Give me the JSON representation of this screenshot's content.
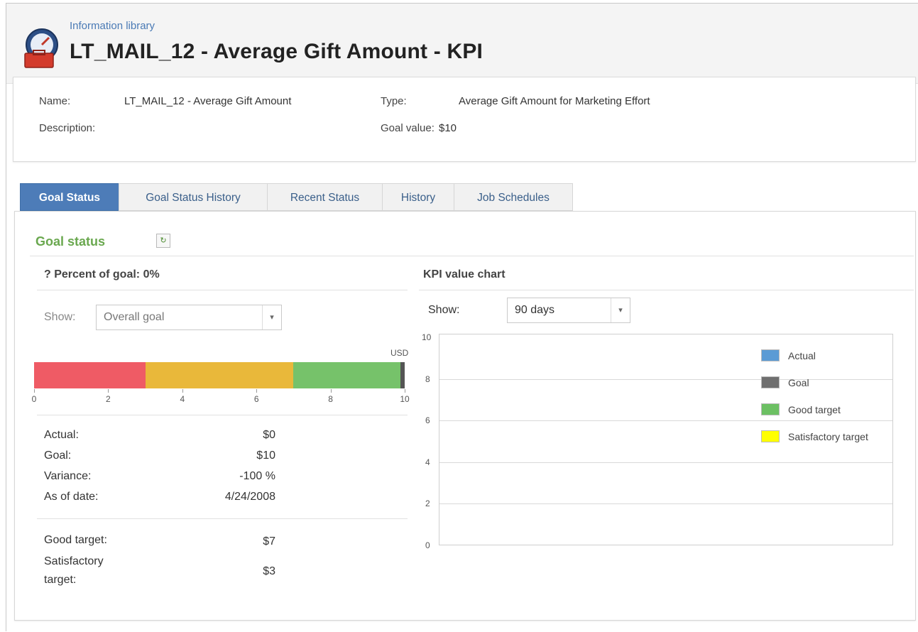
{
  "header": {
    "breadcrumb": "Information library",
    "title": "LT_MAIL_12 - Average Gift Amount - KPI",
    "logo_icon": "toolbox-gauge-icon"
  },
  "info": {
    "name_label": "Name:",
    "name_value": "LT_MAIL_12 - Average Gift Amount",
    "description_label": "Description:",
    "description_value": "",
    "type_label": "Type:",
    "type_value": "Average Gift Amount for Marketing Effort",
    "goal_label": "Goal value:",
    "goal_value": "$10"
  },
  "tabs": [
    {
      "label": "Goal Status",
      "active": true
    },
    {
      "label": "Goal Status History",
      "active": false
    },
    {
      "label": "Recent Status",
      "active": false
    },
    {
      "label": "History",
      "active": false
    },
    {
      "label": "Job Schedules",
      "active": false
    }
  ],
  "goal_status": {
    "title": "Goal status",
    "refresh_icon": "refresh-icon",
    "percent_label": "? Percent of goal: 0%",
    "show_label": "Show:",
    "show_value": "Overall goal",
    "gauge": {
      "unit": "USD",
      "min": 0,
      "max": 10,
      "ticks": [
        "0",
        "2",
        "4",
        "6",
        "8",
        "10"
      ],
      "bands": [
        {
          "from": 0,
          "to": 3,
          "color": "#ef5b65"
        },
        {
          "from": 3,
          "to": 7,
          "color": "#e9b83a"
        },
        {
          "from": 7,
          "to": 10,
          "color": "#76c26a"
        }
      ],
      "goal_marker": 10,
      "goal_color": "#555555"
    },
    "stats": [
      {
        "label": "Actual:",
        "value": "$0"
      },
      {
        "label": "Goal:",
        "value": "$10"
      },
      {
        "label": "Variance:",
        "value": "-100 %"
      },
      {
        "label": "As of date:",
        "value": "4/24/2008"
      }
    ],
    "targets": [
      {
        "label": "Good target:",
        "value": "$7"
      },
      {
        "label": "Satisfactory target:",
        "value": "$3"
      }
    ]
  },
  "kpi_chart": {
    "title": "KPI value chart",
    "show_label": "Show:",
    "show_value": "90 days",
    "y_ticks": [
      "10",
      "8",
      "6",
      "4",
      "2",
      "0"
    ],
    "legend": [
      {
        "label": "Actual",
        "color": "#5b9bd5"
      },
      {
        "label": "Goal",
        "color": "#6f6f6f"
      },
      {
        "label": "Good target",
        "color": "#6cc063"
      },
      {
        "label": "Satisfactory target",
        "color": "#ffff00"
      }
    ]
  }
}
